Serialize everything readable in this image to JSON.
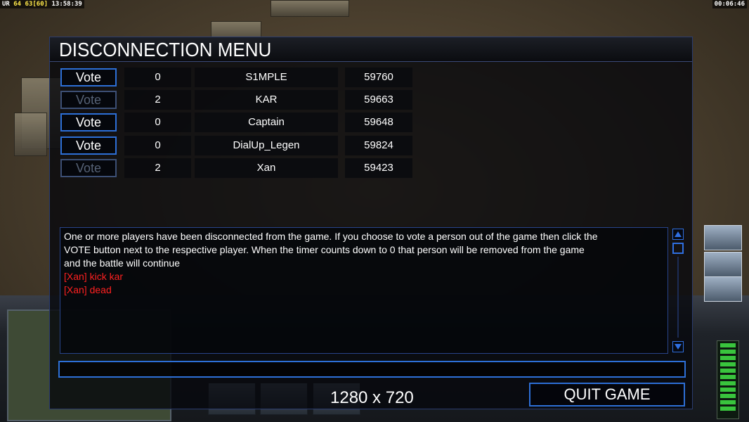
{
  "overlay": {
    "fps_prefix": "UR",
    "fps_a": "64",
    "fps_b": "63",
    "fps_c": "[60]",
    "clock": "13:58:39",
    "game_time": "00:06:46",
    "resolution": "1280 x 720"
  },
  "dialog": {
    "title": "DISCONNECTION MENU",
    "vote_label": "Vote",
    "players": [
      {
        "vote_enabled": true,
        "votes": "0",
        "name": "S1MPLE",
        "ping": "59760"
      },
      {
        "vote_enabled": false,
        "votes": "2",
        "name": "KAR",
        "ping": "59663"
      },
      {
        "vote_enabled": true,
        "votes": "0",
        "name": "Captain",
        "ping": "59648"
      },
      {
        "vote_enabled": true,
        "votes": "0",
        "name": "DialUp_Legen",
        "ping": "59824"
      },
      {
        "vote_enabled": false,
        "votes": "2",
        "name": "Xan",
        "ping": "59423"
      }
    ],
    "messages": [
      {
        "text": "One or more players have been disconnected from the game. If you choose to vote a person out of the game then click the",
        "color": "#ffffff"
      },
      {
        "text": " VOTE button next to the respective player. When the timer counts down to 0 that person will be removed from the game",
        "color": "#ffffff"
      },
      {
        "text": " and the battle will continue",
        "color": "#ffffff"
      },
      {
        "text": "[Xan] kick kar",
        "color": "#ff2020"
      },
      {
        "text": "[Xan] dead",
        "color": "#ff2020"
      }
    ],
    "chat_value": "",
    "quit_label": "QUIT GAME"
  },
  "colors": {
    "accent_border": "#2d6fd6",
    "chat_red": "#ff2020"
  }
}
